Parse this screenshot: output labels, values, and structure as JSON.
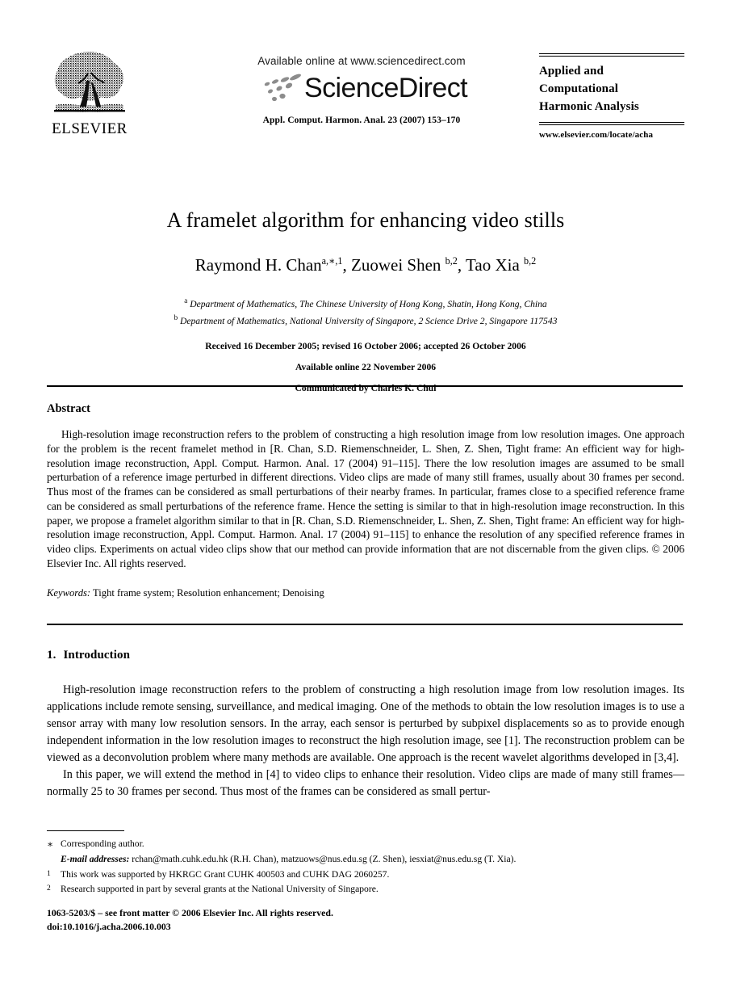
{
  "masthead": {
    "publisher_logo_name": "ELSEVIER",
    "available_online": "Available online at www.sciencedirect.com",
    "sciencedirect_wordmark": "ScienceDirect",
    "journal_reference": "Appl. Comput. Harmon. Anal. 23 (2007) 153–170",
    "journal_name_lines": [
      "Applied and",
      "Computational",
      "Harmonic Analysis"
    ],
    "journal_url": "www.elsevier.com/locate/acha"
  },
  "title_block": {
    "title": "A framelet algorithm for enhancing video stills",
    "authors": [
      {
        "name": "Raymond H. Chan",
        "marks": "a,∗,1",
        "sep": ", "
      },
      {
        "name": "Zuowei Shen ",
        "marks": "b,2",
        "sep": ", "
      },
      {
        "name": "Tao Xia ",
        "marks": "b,2",
        "sep": ""
      }
    ],
    "affiliations": [
      {
        "mark": "a",
        "text": "Department of Mathematics, The Chinese University of Hong Kong, Shatin, Hong Kong, China"
      },
      {
        "mark": "b",
        "text": "Department of Mathematics, National University of Singapore, 2 Science Drive 2, Singapore 117543"
      }
    ],
    "received_line": "Received 16 December 2005; revised 16 October 2006; accepted 26 October 2006",
    "available_line": "Available online 22 November 2006",
    "communicated_line": "Communicated by Charles K. Chui"
  },
  "abstract": {
    "heading": "Abstract",
    "body": "High-resolution image reconstruction refers to the problem of constructing a high resolution image from low resolution images. One approach for the problem is the recent framelet method in [R. Chan, S.D. Riemenschneider, L. Shen, Z. Shen, Tight frame: An efficient way for high-resolution image reconstruction, Appl. Comput. Harmon. Anal. 17 (2004) 91–115]. There the low resolution images are assumed to be small perturbation of a reference image perturbed in different directions. Video clips are made of many still frames, usually about 30 frames per second. Thus most of the frames can be considered as small perturbations of their nearby frames. In particular, frames close to a specified reference frame can be considered as small perturbations of the reference frame. Hence the setting is similar to that in high-resolution image reconstruction. In this paper, we propose a framelet algorithm similar to that in [R. Chan, S.D. Riemenschneider, L. Shen, Z. Shen, Tight frame: An efficient way for high-resolution image reconstruction, Appl. Comput. Harmon. Anal. 17 (2004) 91–115] to enhance the resolution of any specified reference frames in video clips. Experiments on actual video clips show that our method can provide information that are not discernable from the given clips.",
    "copyright": "© 2006 Elsevier Inc. All rights reserved.",
    "keywords_label": "Keywords:",
    "keywords_value": "Tight frame system; Resolution enhancement; Denoising"
  },
  "introduction": {
    "section_number": "1.",
    "section_title": "Introduction",
    "paragraph_1": "High-resolution image reconstruction refers to the problem of constructing a high resolution image from low resolution images. Its applications include remote sensing, surveillance, and medical imaging. One of the methods to obtain the low resolution images is to use a sensor array with many low resolution sensors. In the array, each sensor is perturbed by subpixel displacements so as to provide enough independent information in the low resolution images to reconstruct the high resolution image, see [1]. The reconstruction problem can be viewed as a deconvolution problem where many methods are available. One approach is the recent wavelet algorithms developed in [3,4].",
    "paragraph_2": "In this paper, we will extend the method in [4] to video clips to enhance their resolution. Video clips are made of many still frames—normally 25 to 30 frames per second. Thus most of the frames can be considered as small pertur-"
  },
  "footnotes": [
    {
      "mark": "∗",
      "text": "Corresponding author.",
      "style": "star"
    },
    {
      "mark": "",
      "label": "E-mail addresses:",
      "text": " rchan@math.cuhk.edu.hk (R.H. Chan), matzuows@nus.edu.sg (Z. Shen), iesxiat@nus.edu.sg (T. Xia).",
      "style": "email"
    },
    {
      "mark": "1",
      "text": "This work was supported by HKRGC Grant CUHK 400503 and CUHK DAG 2060257.",
      "style": "num"
    },
    {
      "mark": "2",
      "text": "Research supported in part by several grants at the National University of Singapore.",
      "style": "num"
    }
  ],
  "colophon": {
    "issn_line": "1063-5203/$ – see front matter © 2006 Elsevier Inc. All rights reserved.",
    "doi_line": "doi:10.1016/j.acha.2006.10.003"
  }
}
